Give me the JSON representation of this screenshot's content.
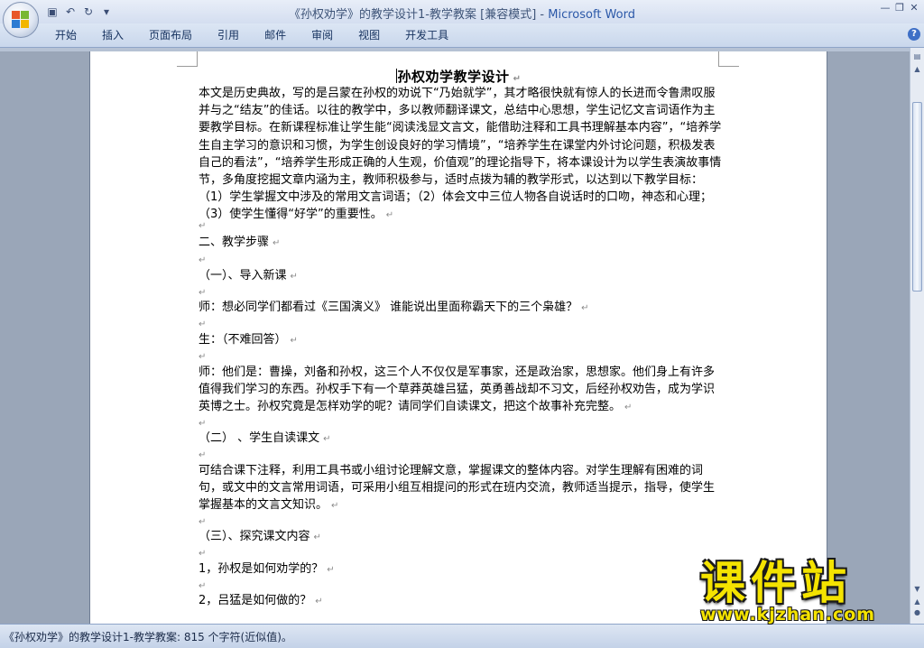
{
  "window": {
    "title": "《孙权劝学》的教学设计1-教学教案 [兼容模式]",
    "title_sep": " - ",
    "app_name": "Microsoft Word"
  },
  "ribbon": {
    "tabs": [
      {
        "label": "开始"
      },
      {
        "label": "插入"
      },
      {
        "label": "页面布局"
      },
      {
        "label": "引用"
      },
      {
        "label": "邮件"
      },
      {
        "label": "审阅"
      },
      {
        "label": "视图"
      },
      {
        "label": "开发工具"
      }
    ]
  },
  "document": {
    "title": "孙权劝学教学设计",
    "paragraphs": [
      "本文是历史典故，写的是吕蒙在孙权的劝说下“乃始就学”，其才略很快就有惊人的长进而令鲁肃叹服并与之“结友”的佳话。以往的教学中，多以教师翻译课文，总结中心思想，学生记忆文言词语作为主要教学目标。在新课程标准让学生能“阅读浅显文言文，能借助注释和工具书理解基本内容”，“培养学生自主学习的意识和习惯，为学生创设良好的学习情境”，“培养学生在课堂内外讨论问题，积极发表自己的看法”，“培养学生形成正确的人生观，价值观”的理论指导下，将本课设计为以学生表演故事情节，多角度挖掘文章内涵为主，教师积极参与，适时点拨为辅的教学形式，以达到以下教学目标：（1）学生掌握文中涉及的常用文言词语；（2）体会文中三位人物各自说话时的口吻，神态和心理；（3）使学生懂得“好学”的重要性。",
      "二、教学步骤",
      "（一）、导入新课",
      "师：想必同学们都看过《三国演义》 谁能说出里面称霸天下的三个枭雄？",
      "生：（不难回答）",
      "师：他们是：曹操，刘备和孙权，这三个人不仅仅是军事家，还是政治家，思想家。他们身上有许多值得我们学习的东西。孙权手下有一个草莽英雄吕猛，英勇善战却不习文，后经孙权劝告，成为学识英博之士。孙权究竟是怎样劝学的呢？请同学们自读课文，把这个故事补充完整。",
      "（二） 、学生自读课文",
      "可结合课下注释，利用工具书或小组讨论理解文意，掌握课文的整体内容。对学生理解有困难的词句，或文中的文言常用词语，可采用小组互相提问的形式在班内交流，教师适当提示，指导，使学生掌握基本的文言文知识。",
      "（三）、探究课文内容",
      "1，孙权是如何劝学的？",
      "2，吕猛是如何做的？"
    ]
  },
  "statusbar": {
    "text": "《孙权劝学》的教学设计1-教学教案: 815 个字符(近似值)。"
  },
  "watermark": {
    "chinese": "课件站",
    "url": "www.kjzhan.com"
  },
  "colors": {
    "accent": "#2b58a8",
    "watermark_yellow": "#f4e300"
  }
}
